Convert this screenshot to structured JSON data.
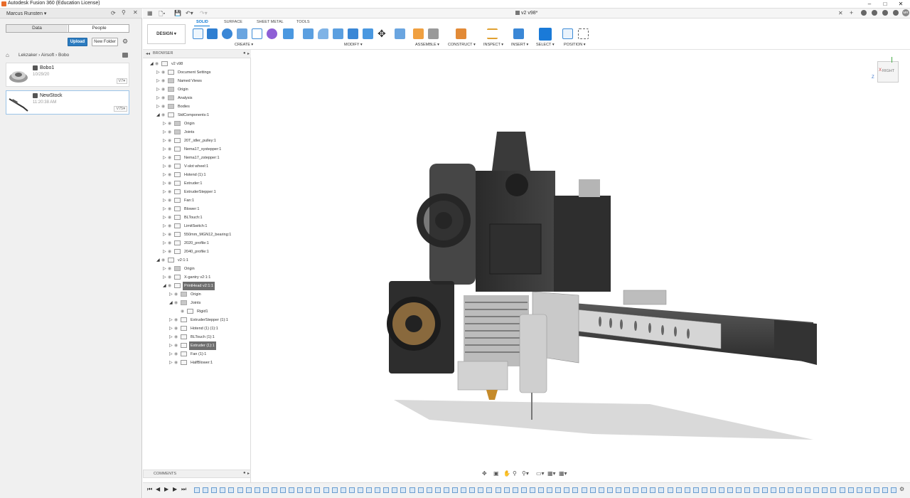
{
  "app": {
    "title": "Autodesk Fusion 360 (Education License)",
    "accent": "#0d79d4"
  },
  "user": {
    "name": "Marcus Runsten"
  },
  "data_panel": {
    "tabs": [
      "Data",
      "People"
    ],
    "upload_label": "Upload",
    "new_folder_label": "New Folder",
    "breadcrumb": "Lekzaker › Airsoft › Bobo",
    "files": [
      {
        "name": "Bobo1",
        "date": "10/29/20",
        "version": "V7"
      },
      {
        "name": "NewStock",
        "date": "11:20:38 AM",
        "version": "V75"
      }
    ]
  },
  "document": {
    "title": "v2 v98*"
  },
  "workspace_tabs": [
    "SOLID",
    "SURFACE",
    "SHEET METAL",
    "TOOLS"
  ],
  "design_label": "DESIGN ▾",
  "tool_groups": [
    "CREATE ▾",
    "MODIFY ▾",
    "ASSEMBLE ▾",
    "CONSTRUCT ▾",
    "INSPECT ▾",
    "INSERT ▾",
    "SELECT ▾",
    "POSITION ▾"
  ],
  "browser": {
    "title": "BROWSER",
    "items": [
      {
        "label": "v2 v98",
        "level": 0,
        "expanded": true
      },
      {
        "label": "Document Settings",
        "level": 1
      },
      {
        "label": "Named Views",
        "level": 1
      },
      {
        "label": "Origin",
        "level": 1
      },
      {
        "label": "Analysis",
        "level": 1
      },
      {
        "label": "Bodies",
        "level": 1
      },
      {
        "label": "StdComponents:1",
        "level": 1,
        "expanded": true
      },
      {
        "label": "Origin",
        "level": 2
      },
      {
        "label": "Joints",
        "level": 2
      },
      {
        "label": "20T_idler_pulley:1",
        "level": 2
      },
      {
        "label": "Nema17_xystepper:1",
        "level": 2
      },
      {
        "label": "Nema17_zstepper:1",
        "level": 2
      },
      {
        "label": "V-slot wheel:1",
        "level": 2
      },
      {
        "label": "Hotend (1):1",
        "level": 2
      },
      {
        "label": "Extruder:1",
        "level": 2
      },
      {
        "label": "ExtruderStepper:1",
        "level": 2
      },
      {
        "label": "Fan:1",
        "level": 2
      },
      {
        "label": "Blower:1",
        "level": 2
      },
      {
        "label": "BLTouch:1",
        "level": 2
      },
      {
        "label": "LimitSwitch:1",
        "level": 2
      },
      {
        "label": "550mm_MGN12_bearing:1",
        "level": 2
      },
      {
        "label": "2020_profile:1",
        "level": 2
      },
      {
        "label": "2040_profile:1",
        "level": 2
      },
      {
        "label": "v2:1:1",
        "level": 1,
        "expanded": true
      },
      {
        "label": "Origin",
        "level": 2
      },
      {
        "label": "X-gantry v2:1:1",
        "level": 2
      },
      {
        "label": "PrintHead v2:1:1",
        "level": 2,
        "expanded": true,
        "highlight": true
      },
      {
        "label": "Origin",
        "level": 3
      },
      {
        "label": "Joints",
        "level": 3,
        "expanded": true
      },
      {
        "label": "Rigid1",
        "level": 4
      },
      {
        "label": "ExtruderStepper (1):1",
        "level": 3
      },
      {
        "label": "Hotend (1) (1):1",
        "level": 3
      },
      {
        "label": "BLTouch (1):1",
        "level": 3
      },
      {
        "label": "Extruder (1):1",
        "level": 3,
        "highlight": true
      },
      {
        "label": "Fan (1):1",
        "level": 3
      },
      {
        "label": "HalfBlower:1",
        "level": 3
      }
    ]
  },
  "comments": {
    "title": "COMMENTS"
  },
  "viewcube": {
    "face": "RIGHT",
    "axis_z": "Z",
    "axis_x": "X"
  }
}
